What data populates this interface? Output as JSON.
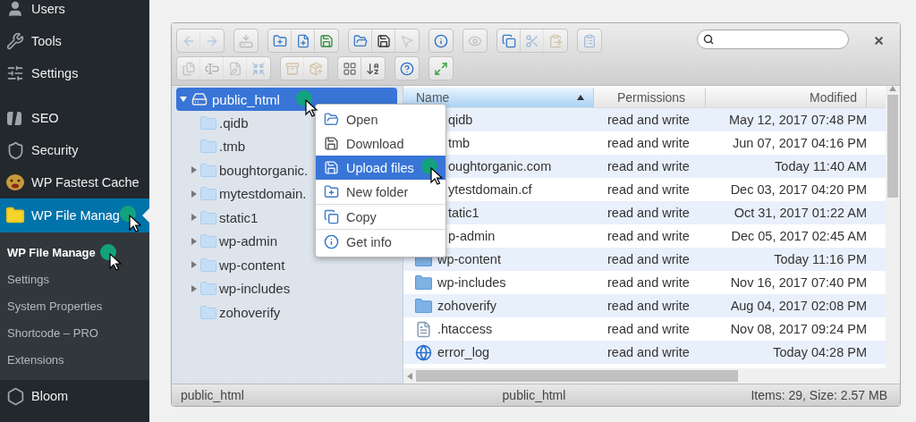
{
  "sidebar": {
    "groups": [
      [
        {
          "kind": "users",
          "label": "Users",
          "selected": false
        },
        {
          "kind": "tools",
          "label": "Tools",
          "selected": false
        },
        {
          "kind": "settings",
          "label": "Settings",
          "selected": false
        }
      ],
      [
        {
          "kind": "seo",
          "label": "SEO",
          "selected": false
        },
        {
          "kind": "security",
          "label": "Security",
          "selected": false
        },
        {
          "kind": "cache",
          "label": "WP Fastest Cache",
          "selected": false
        },
        {
          "kind": "file-manager",
          "label": "WP File Manag",
          "selected": true,
          "submenu": [
            {
              "label": "WP File Manage",
              "selected": true
            },
            {
              "label": "Settings",
              "selected": false
            },
            {
              "label": "System Properties",
              "selected": false
            },
            {
              "label": "Shortcode – PRO",
              "selected": false
            },
            {
              "label": "Extensions",
              "selected": false
            }
          ]
        },
        {
          "kind": "bloom",
          "label": "Bloom",
          "selected": false
        }
      ]
    ]
  },
  "toolbar": {
    "rows": [
      [
        [
          {
            "kind": "back",
            "disabled": true
          },
          {
            "kind": "forward",
            "disabled": true
          }
        ],
        [
          {
            "kind": "netmount",
            "disabled": true
          }
        ],
        [
          {
            "kind": "mkdir",
            "disabled": false
          },
          {
            "kind": "mkfile",
            "disabled": false
          },
          {
            "kind": "upload",
            "disabled": false
          }
        ],
        [
          {
            "kind": "open",
            "disabled": false
          },
          {
            "kind": "download",
            "disabled": false
          },
          {
            "kind": "select",
            "disabled": true
          }
        ],
        [
          {
            "kind": "info",
            "disabled": false
          }
        ],
        [
          {
            "kind": "preview",
            "disabled": true
          }
        ],
        [
          {
            "kind": "copy",
            "disabled": false
          },
          {
            "kind": "cut",
            "disabled": true
          },
          {
            "kind": "paste",
            "disabled": true
          }
        ],
        [
          {
            "kind": "clipboard",
            "disabled": true
          }
        ]
      ],
      [
        [
          {
            "kind": "duplicate",
            "disabled": true
          },
          {
            "kind": "rename",
            "disabled": true
          },
          {
            "kind": "edit",
            "disabled": true
          },
          {
            "kind": "resize",
            "disabled": true
          }
        ],
        [
          {
            "kind": "extract",
            "disabled": true
          },
          {
            "kind": "archive",
            "disabled": true
          }
        ],
        [
          {
            "kind": "view",
            "disabled": false
          },
          {
            "kind": "sort",
            "disabled": false
          }
        ],
        [
          {
            "kind": "help",
            "disabled": false
          }
        ],
        [
          {
            "kind": "fullscreen",
            "disabled": false
          }
        ]
      ]
    ]
  },
  "tree": {
    "label": "public_html",
    "selected": true,
    "expanded": true,
    "children": [
      {
        "label": ".qidb",
        "expandable": false
      },
      {
        "label": ".tmb",
        "expandable": false
      },
      {
        "label": "boughtorganic.",
        "expandable": true
      },
      {
        "label": "mytestdomain.",
        "expandable": true
      },
      {
        "label": "static1",
        "expandable": true
      },
      {
        "label": "wp-admin",
        "expandable": true
      },
      {
        "label": "wp-content",
        "expandable": true
      },
      {
        "label": "wp-includes",
        "expandable": true
      },
      {
        "label": "zohoverify",
        "expandable": false
      }
    ]
  },
  "context_menu": {
    "groups": [
      [
        {
          "kind": "open",
          "label": "Open",
          "selected": false
        },
        {
          "kind": "download",
          "label": "Download",
          "selected": false
        },
        {
          "kind": "upload",
          "label": "Upload files",
          "selected": true
        },
        {
          "kind": "mkdir",
          "label": "New folder",
          "selected": false
        }
      ],
      [
        {
          "kind": "copy",
          "label": "Copy",
          "selected": false
        }
      ],
      [
        {
          "kind": "info",
          "label": "Get info",
          "selected": false
        }
      ]
    ]
  },
  "list": {
    "columns": [
      {
        "label": "Name",
        "sorted": true
      },
      {
        "label": "Permissions",
        "sorted": false
      },
      {
        "label": "Modified",
        "sorted": false
      }
    ],
    "rows": [
      {
        "name": "qidb",
        "permissions": "read and write",
        "modified": "May 12, 2017 07:48 PM"
      },
      {
        "name": "tmb",
        "permissions": "read and write",
        "modified": "Jun 07, 2017 04:16 PM"
      },
      {
        "name": "oughtorganic.com",
        "permissions": "read and write",
        "modified": "Today 11:40 AM"
      },
      {
        "name": "ytestdomain.cf",
        "permissions": "read and write",
        "modified": "Dec 03, 2017 04:20 PM"
      },
      {
        "name": "tatic1",
        "permissions": "read and write",
        "modified": "Oct 31, 2017 01:22 AM"
      },
      {
        "name": "p-admin",
        "permissions": "read and write",
        "modified": "Dec 05, 2017 02:45 AM"
      },
      {
        "kind": "folder",
        "name": "wp-content",
        "permissions": "read and write",
        "modified": "Today 11:16 PM"
      },
      {
        "kind": "folder",
        "name": "wp-includes",
        "permissions": "read and write",
        "modified": "Nov 16, 2017 07:40 PM"
      },
      {
        "kind": "folder",
        "name": "zohoverify",
        "permissions": "read and write",
        "modified": "Aug 04, 2017 02:08 PM"
      },
      {
        "kind": "file",
        "name": ".htaccess",
        "permissions": "read and write",
        "modified": "Nov 08, 2017 09:24 PM"
      },
      {
        "kind": "globe",
        "name": "error_log",
        "permissions": "read and write",
        "modified": "Today 04:28 PM"
      }
    ]
  },
  "status_bar": {
    "left": "public_html",
    "center": "public_html",
    "right": "Items: 29, Size: 2.57 MB"
  }
}
